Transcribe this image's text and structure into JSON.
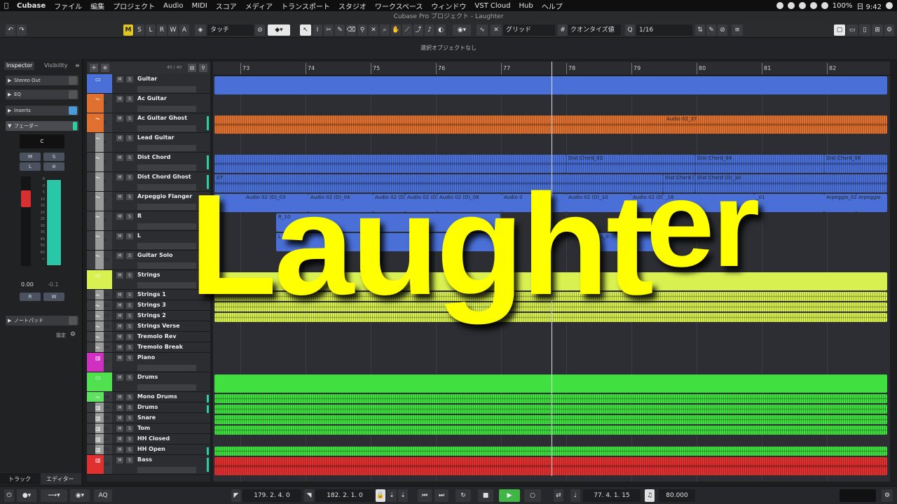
{
  "menubar": {
    "apple": "",
    "app": "Cubase",
    "items": [
      "ファイル",
      "編集",
      "プロジェクト",
      "Audio",
      "MIDI",
      "スコア",
      "メディア",
      "トランスポート",
      "スタジオ",
      "ワークスペース",
      "ウィンドウ",
      "VST Cloud",
      "Hub",
      "ヘルプ"
    ],
    "battery": "100%",
    "clock": "日 9:42"
  },
  "window": {
    "title": "Cubase Pro プロジェクト - Laughter"
  },
  "toolbar": {
    "modes": [
      "M",
      "S",
      "L",
      "R",
      "W",
      "A"
    ],
    "automation_mode": "タッチ",
    "snap_type": "グリッド",
    "quantize_label": "クオンタイズ値",
    "quantize_value": "1/16"
  },
  "infoline": {
    "text": "選択オブジェクトなし"
  },
  "inspector": {
    "tabs": [
      "Inspector",
      "Visibility"
    ],
    "output": "Stereo Out",
    "eq": "EQ",
    "inserts": "Inserts",
    "fader": "フェーダー",
    "pan": "C",
    "volume": "0.00",
    "peak": "-0.1",
    "notepad": "ノートパッド",
    "settings": "設定",
    "fader_scale": [
      "6",
      "0",
      "5",
      "10",
      "15",
      "20",
      "25",
      "30",
      "35",
      "40",
      "50",
      "60",
      "∞"
    ]
  },
  "tracklist": {
    "counter": "40 / 40",
    "tracks": [
      {
        "name": "Guitar",
        "num": "",
        "color": "#4a70d8",
        "type": "folder"
      },
      {
        "name": "Ac Guitar",
        "num": "2",
        "color": "#e07030",
        "type": "audio"
      },
      {
        "name": "Ac Guitar Ghost",
        "num": "3",
        "color": "#e07030",
        "type": "audio"
      },
      {
        "name": "Lead Guitar",
        "num": "4",
        "color": "#9a9a9a",
        "type": "audio"
      },
      {
        "name": "Dist Chord",
        "num": "5",
        "color": "#9a9a9a",
        "type": "audio"
      },
      {
        "name": "Dist Chord Ghost",
        "num": "6",
        "color": "#9a9a9a",
        "type": "audio"
      },
      {
        "name": "Arpeggio Flanger",
        "num": "7",
        "color": "#9a9a9a",
        "type": "audio"
      },
      {
        "name": "R",
        "num": "8",
        "color": "#9a9a9a",
        "type": "audio"
      },
      {
        "name": "L",
        "num": "9",
        "color": "#9a9a9a",
        "type": "audio"
      },
      {
        "name": "Guitar Solo",
        "num": "10",
        "color": "#9a9a9a",
        "type": "audio"
      },
      {
        "name": "Strings",
        "num": "",
        "color": "#d8f050",
        "type": "folder"
      },
      {
        "name": "Strings 1",
        "num": "11",
        "color": "#9a9a9a",
        "type": "audio"
      },
      {
        "name": "Strings 3",
        "num": "12",
        "color": "#9a9a9a",
        "type": "audio"
      },
      {
        "name": "Strings 2",
        "num": "13",
        "color": "#9a9a9a",
        "type": "audio"
      },
      {
        "name": "Strings Verse",
        "num": "14",
        "color": "#9a9a9a",
        "type": "audio"
      },
      {
        "name": "Tremolo Rev",
        "num": "15",
        "color": "#9a9a9a",
        "type": "audio"
      },
      {
        "name": "Tremolo Break",
        "num": "16",
        "color": "#9a9a9a",
        "type": "audio"
      },
      {
        "name": "Piano",
        "num": "17",
        "color": "#d030c0",
        "type": "instrument"
      },
      {
        "name": "Drums",
        "num": "",
        "color": "#50e050",
        "type": "folder"
      },
      {
        "name": "Mono Drums",
        "num": "18",
        "color": "#60e060",
        "type": "audio"
      },
      {
        "name": "Drums",
        "num": "19",
        "color": "#9a9a9a",
        "type": "instrument"
      },
      {
        "name": "Snare",
        "num": "20",
        "color": "#9a9a9a",
        "type": "instrument"
      },
      {
        "name": "Tom",
        "num": "21",
        "color": "#9a9a9a",
        "type": "instrument"
      },
      {
        "name": "HH Closed",
        "num": "22",
        "color": "#9a9a9a",
        "type": "instrument"
      },
      {
        "name": "HH Open",
        "num": "23",
        "color": "#9a9a9a",
        "type": "instrument"
      },
      {
        "name": "Bass",
        "num": "24",
        "color": "#e03030",
        "type": "instrument"
      }
    ]
  },
  "ruler": {
    "bars": [
      "73",
      "74",
      "75",
      "76",
      "77",
      "78",
      "79",
      "80",
      "81",
      "82"
    ]
  },
  "clips": {
    "audio_02_37": "Audio 02_37",
    "dist_chord_03": "Dist Chord_03",
    "dist_chord_04": "Dist Chord_04",
    "dist_chord_06": "Dist Chord_06",
    "dist_chord_ghost_07": "07",
    "dist_chord_g": "Dist Chord (",
    "dist_chord_10": "Dist Chord (D)_10",
    "arp_03": "Audio 02 (D)_03",
    "arp_04": "Audio 02 (D)_04",
    "arp_a": "Audio 02 (D)",
    "arp_b": "Audio 02 (D)",
    "arp_08": "Audio 02 (D)_08",
    "arp_c": "Audio 0",
    "arp_10": "Audio 02 (D)_10",
    "arp_d": "Audio 02 (D)",
    "arp_16": "_16",
    "arp_01": "_01",
    "arpeggio_02": "Arpeggio_02",
    "arpeggio": "Arpeggio",
    "r_10": "R_10",
    "l_01": "L_01",
    "l_02": "L_0"
  },
  "bottomtabs": {
    "track": "トラック",
    "editor": "エディター"
  },
  "transport": {
    "left_locator": "179. 2. 4.   0",
    "right_locator": "182. 2. 1.   0",
    "position": "77. 4. 1. 15",
    "tempo": "80.000",
    "aq": "AQ"
  },
  "overlay": {
    "main": "Laugh",
    "t": "t",
    "sup": "er"
  },
  "colors": {
    "guitar_blue": "#4a70d8",
    "orange": "#e07030",
    "strings_yellow": "#d8f050",
    "drums_green": "#40e040",
    "bass_red": "#e03030",
    "overlay_yellow": "#ffff00"
  }
}
